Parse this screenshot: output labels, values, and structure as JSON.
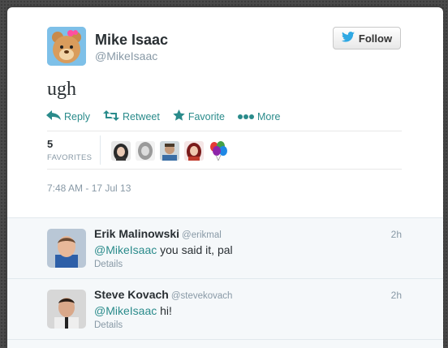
{
  "tweet": {
    "author_name": "Mike Isaac",
    "author_handle": "@MikeIsaac",
    "follow_label": "Follow",
    "text": "ugh",
    "timestamp": "7:48 AM - 17 Jul 13"
  },
  "actions": {
    "reply": "Reply",
    "retweet": "Retweet",
    "favorite": "Favorite",
    "more": "More"
  },
  "stats": {
    "favorites_count": "5",
    "favorites_label": "FAVORITES"
  },
  "replies": [
    {
      "name": "Erik Malinowski",
      "handle": "@erikmal",
      "time": "2h",
      "mention": "@MikeIsaac",
      "text": " you said it, pal",
      "details": "Details"
    },
    {
      "name": "Steve Kovach",
      "handle": "@stevekovach",
      "time": "2h",
      "mention": "@MikeIsaac",
      "text": " hi!",
      "details": "Details"
    }
  ],
  "colors": {
    "link_teal": "#2a8b8b",
    "twitter_blue": "#2fa8e3",
    "muted_gray": "#8899a6"
  },
  "icons": [
    "twitter-bird-icon",
    "reply-arrow-icon",
    "retweet-icon",
    "star-icon",
    "more-dots-icon"
  ]
}
